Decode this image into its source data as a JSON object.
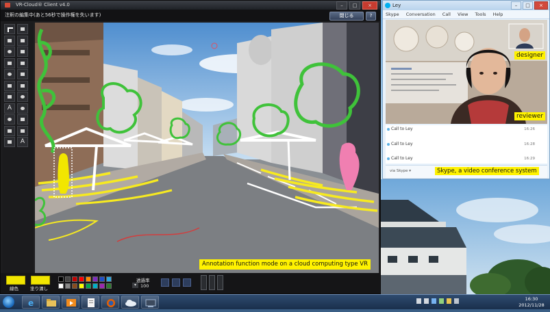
{
  "vr_client": {
    "title": "VR-Cloud® Client v4.0",
    "status_message": "注釈の編集中(あと56秒で操作権を失います)",
    "close_button": "閉じる",
    "help_button": "?",
    "window_controls": {
      "minimize": "–",
      "maximize": "□",
      "close": "×"
    },
    "tools": [
      "select-arrow",
      "freehand-pen",
      "curve",
      "polygon",
      "burst-star",
      "rectangle",
      "triangle",
      "cross",
      "star",
      "diamond",
      "arrow-right",
      "callout-cloud",
      "callout-box",
      "circle",
      "text-a",
      "cloud",
      "cloud-alt",
      "line-arrow",
      "line-alt",
      "box-a",
      "box-b",
      "text-small"
    ],
    "tool_glyphs": {
      "text-a": "A",
      "text-small": "A"
    },
    "annotation_caption": "Annotation function mode on a cloud computing type VR",
    "bottom_toolbar": {
      "line_label": "線色",
      "fill_label": "塗り潰し",
      "opacity_label": "透過率",
      "opacity_value": "100",
      "line_color": "#f2e600",
      "fill_color": "#f2e600",
      "palette": [
        "#000000",
        "#444444",
        "#c00000",
        "#ff0000",
        "#ff8c00",
        "#7d2bbf",
        "#1f4ec8",
        "#2ea7e0",
        "#ffffff",
        "#888888",
        "#8a4b1c",
        "#ffff00",
        "#00a651",
        "#00b0c8",
        "#9c27b0",
        "#2d7a2d"
      ]
    }
  },
  "skype": {
    "title": "Ley",
    "menu": [
      "Skype",
      "Conversation",
      "Call",
      "View",
      "Tools",
      "Help"
    ],
    "labels": {
      "designer": "designer",
      "reviewer": "reviewer",
      "system": "Skype, a video conference system"
    },
    "calls": [
      {
        "text": "Call to Ley",
        "time": "16:26"
      },
      {
        "text": "Call to Ley",
        "time": "16:28"
      },
      {
        "text": "Call to Ley",
        "time": "16:29"
      }
    ],
    "via": "via Skype ▾"
  },
  "taskbar": {
    "apps": [
      "internet-explorer",
      "explorer",
      "media-player",
      "document",
      "firefox",
      "cloud-app",
      "vr-client"
    ],
    "time": "16:30",
    "date": "2012/11/28"
  }
}
